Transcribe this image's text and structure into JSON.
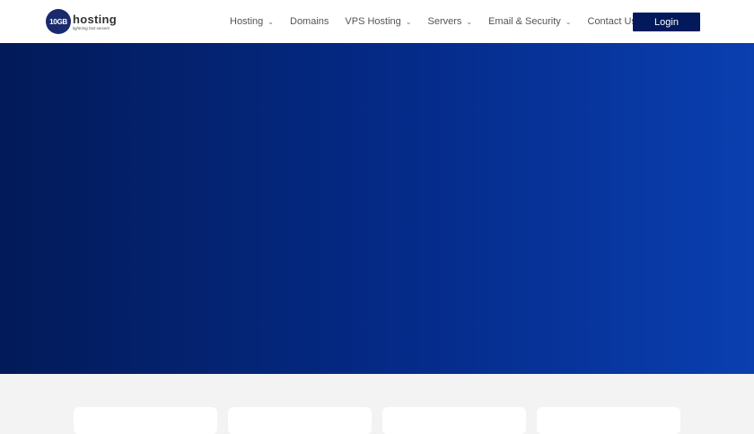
{
  "logo": {
    "mark": "10GB",
    "brand": "hosting",
    "tagline": "lightning fast servers"
  },
  "nav": {
    "items": [
      {
        "label": "Hosting",
        "dropdown": true
      },
      {
        "label": "Domains",
        "dropdown": false
      },
      {
        "label": "VPS Hosting",
        "dropdown": true
      },
      {
        "label": "Servers",
        "dropdown": true
      },
      {
        "label": "Email & Security",
        "dropdown": true
      },
      {
        "label": "Contact Us",
        "dropdown": false
      }
    ],
    "login_label": "Login"
  },
  "colors": {
    "brand": "#021a5c",
    "hero_start": "#021a58",
    "hero_end": "#0a3fb0"
  }
}
